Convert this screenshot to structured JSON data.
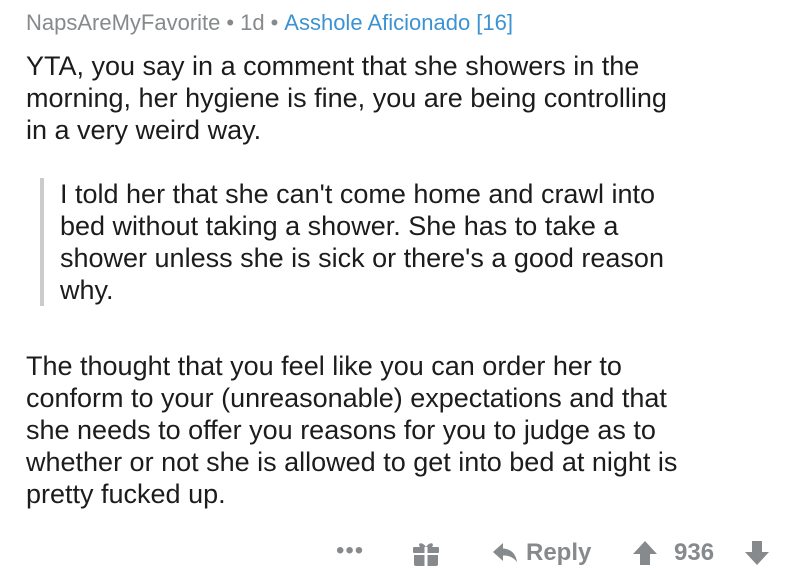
{
  "comment": {
    "username": "NapsAreMyFavorite",
    "separator": "•",
    "age": "1d",
    "flair": "Asshole Aficionado [16]",
    "paragraph1": [
      "YTA, you say in a comment that she showers in the",
      "morning, her hygiene is fine, you are being controlling",
      "in a very weird way."
    ],
    "quote": [
      "I told her that she can't come home and crawl into",
      "bed without taking a shower. She has to take a",
      "shower unless she is sick or there's a good reason",
      "why."
    ],
    "paragraph2": [
      "The thought that you feel like you can order her to",
      "conform to your (unreasonable) expectations and that",
      "she needs to offer you reasons for you to judge as to",
      "whether or not she is allowed to get into bed at night is",
      "pretty fucked up."
    ]
  },
  "actions": {
    "more_label": "•••",
    "award_icon": "gift-icon",
    "reply_icon": "reply-arrow-icon",
    "reply_label": "Reply",
    "upvote_icon": "upvote-arrow-icon",
    "score": "936",
    "downvote_icon": "downvote-arrow-icon"
  },
  "colors": {
    "text": "#1c1c1c",
    "meta": "#878a8c",
    "flair": "#3d93d1",
    "quote_bar": "#c9cbcd"
  }
}
